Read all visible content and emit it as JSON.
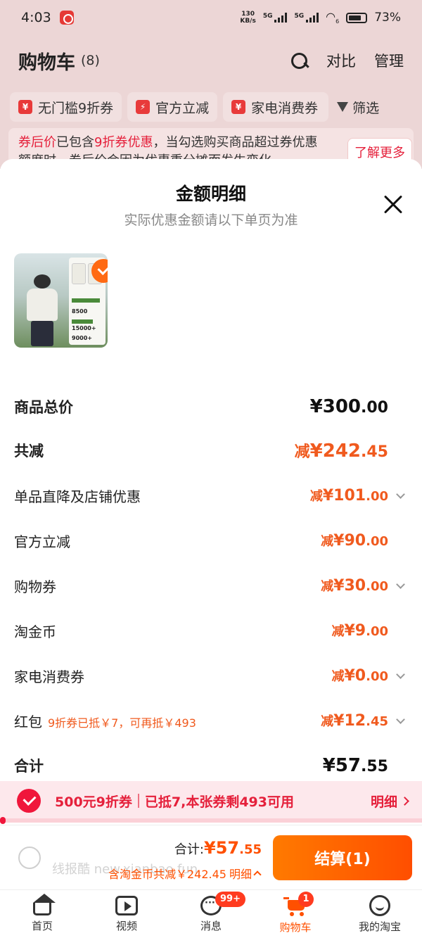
{
  "status_bar": {
    "time": "4:03",
    "net_speed": "130",
    "net_unit": "KB/s",
    "sig1": "5G",
    "sig2": "5G",
    "wifi_suffix": "6",
    "battery": "73%"
  },
  "cart_header": {
    "title": "购物车",
    "count": "(8)",
    "compare": "对比",
    "manage": "管理",
    "search_icon": "search-icon"
  },
  "chips": [
    {
      "label": "无门槛9折券",
      "icon": "¥"
    },
    {
      "label": "官方立减",
      "icon": "⚡"
    },
    {
      "label": "家电消费券",
      "icon": "¥"
    }
  ],
  "filter_label": "筛选",
  "promo": {
    "red1": "券后价",
    "text1": "已包含",
    "red2": "9折券优惠",
    "text2": "，当勾选购买商品超过券优惠额度时，券后价会因为优惠重分摊而发生变化",
    "learn_more": "了解更多"
  },
  "sheet": {
    "title": "金额明细",
    "subtitle": "实际优惠金额请以下单页为准"
  },
  "thumb": {
    "num1": "8500",
    "num2": "15000+",
    "num3": "9000+"
  },
  "rows": {
    "goods_total": {
      "label": "商品总价",
      "prefix": "",
      "int": "¥300",
      "dec": ".00"
    },
    "total_discount": {
      "label": "共减",
      "prefix": "减",
      "int": "¥242",
      "dec": ".45"
    },
    "item_discount": {
      "label": "单品直降及店铺优惠",
      "prefix": "减",
      "int": "¥101",
      "dec": ".00"
    },
    "official": {
      "label": "官方立减",
      "prefix": "减",
      "int": "¥90",
      "dec": ".00"
    },
    "coupon": {
      "label": "购物券",
      "prefix": "减",
      "int": "¥30",
      "dec": ".00"
    },
    "taojinbi": {
      "label": "淘金币",
      "prefix": "减",
      "int": "¥9",
      "dec": ".00"
    },
    "appliance": {
      "label": "家电消费券",
      "prefix": "减",
      "int": "¥0",
      "dec": ".00"
    },
    "red_packet": {
      "label": "红包",
      "note": "9折券已抵￥7，可再抵￥493",
      "prefix": "减",
      "int": "¥12",
      "dec": ".45"
    },
    "sum": {
      "label": "合计",
      "prefix": "",
      "int": "¥57",
      "dec": ".55"
    }
  },
  "coupon_bar": {
    "name": "500元9折券",
    "info": "已抵7,本张券剩493可用",
    "detail": "明细"
  },
  "checkout": {
    "total_label": "合计:",
    "total_int": "¥57",
    "total_dec": ".55",
    "save_text": "含淘金币共减￥242.45",
    "save_link": "明细",
    "watermark": "线报酷 new.xianbao.fun",
    "pay_button": "结算(1)"
  },
  "tabbar": [
    {
      "label": "首页",
      "icon": "home-icon"
    },
    {
      "label": "视频",
      "icon": "video-icon"
    },
    {
      "label": "消息",
      "icon": "message-icon",
      "badge": "99+"
    },
    {
      "label": "购物车",
      "icon": "cart-icon",
      "badge": "1"
    },
    {
      "label": "我的淘宝",
      "icon": "smile-icon"
    }
  ],
  "colors": {
    "accent": "#ff5000",
    "discount": "#f05a1e",
    "coupon_red": "#e5203b"
  }
}
